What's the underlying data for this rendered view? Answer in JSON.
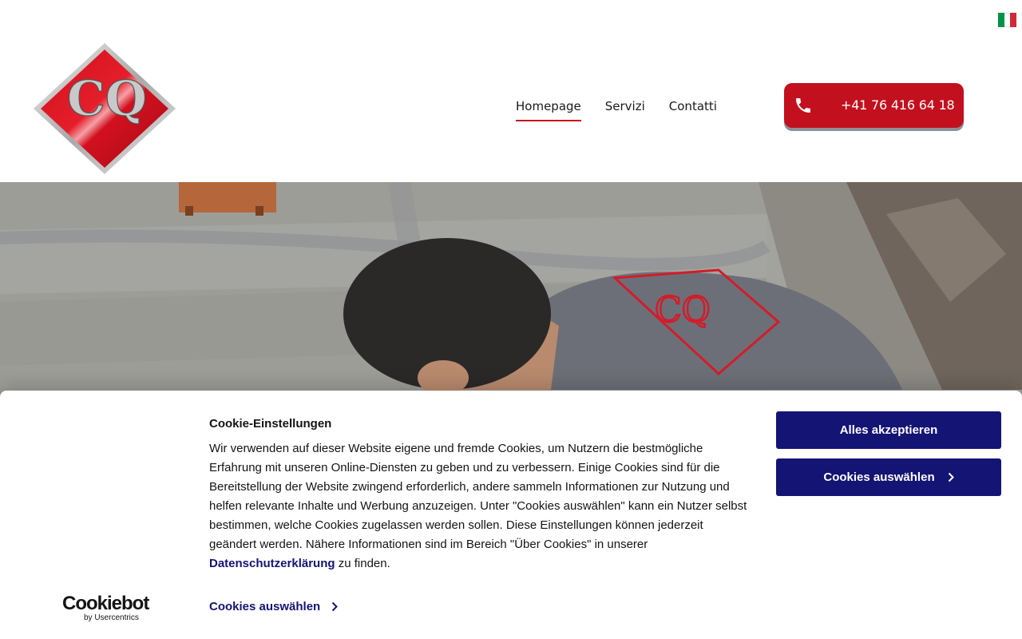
{
  "header": {
    "language_flag": "italian-flag-icon",
    "logo_letters": "CQ",
    "nav": [
      {
        "label": "Homepage",
        "active": true
      },
      {
        "label": "Servizi",
        "active": false
      },
      {
        "label": "Contatti",
        "active": false
      }
    ],
    "phone_button": {
      "icon": "phone-icon",
      "label": "+41 76 416 64 18"
    }
  },
  "cookie_banner": {
    "brand_name": "Cookiebot",
    "brand_sub": "by Usercentrics",
    "title": "Cookie-Einstellungen",
    "text_before_link": "Wir verwenden auf dieser Website eigene und fremde Cookies, um Nutzern die bestmögliche Erfahrung mit unseren Online-Diensten zu geben und zu verbessern. Einige Cookies sind für die Bereitstellung der Website zwingend erforderlich, andere sammeln Informationen zur Nutzung und helfen relevante Inhalte und Werbung anzuzeigen. Unter \"Cookies auswählen\" kann ein Nutzer selbst bestimmen, welche Cookies zugelassen werden sollen. Diese Einstellungen können jederzeit geändert werden. Nähere Informationen sind im Bereich \"Über Cookies\" in unserer",
    "link_label": "Datenschutzerklärung",
    "text_after_link": "zu finden.",
    "details_link": "Cookies auswählen",
    "accept_button": "Alles akzeptieren",
    "select_button": "Cookies auswählen"
  },
  "colors": {
    "brand_red": "#c3101e",
    "cookie_blue": "#141475",
    "flag_green": "#009246",
    "flag_white": "#ffffff",
    "flag_red": "#ce2b37"
  }
}
